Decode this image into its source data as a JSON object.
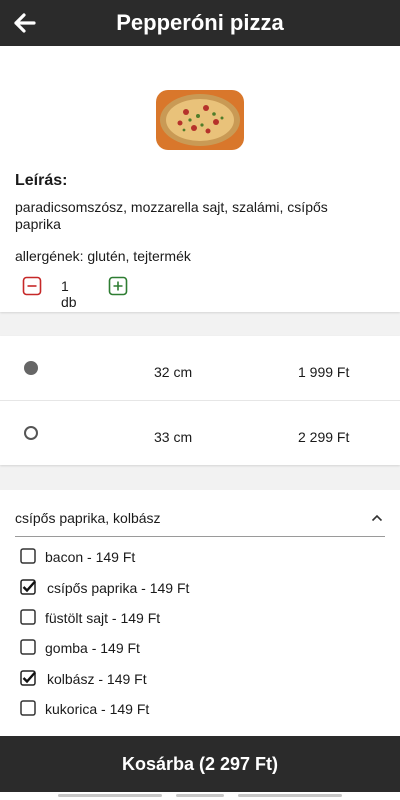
{
  "header": {
    "title": "Pepperóni pizza",
    "back_icon": "arrow-left-icon"
  },
  "product": {
    "image_icon": "pizza-photo",
    "description_heading": "Leírás:",
    "description": "paradicsomszósz, mozzarella  sajt, szalámi, csípős paprika",
    "allergens": "allergének: glutén, tejtermék",
    "quantity": "1 db",
    "minus_icon": "minus-square-icon",
    "plus_icon": "plus-square-icon",
    "colors": {
      "minus": "#c62828",
      "plus": "#2e7d32"
    }
  },
  "sizes": [
    {
      "label": "32 cm",
      "price": "1 999 Ft",
      "selected": true
    },
    {
      "label": "33 cm",
      "price": "2 299 Ft",
      "selected": false
    }
  ],
  "extras": {
    "selected_summary": "csípős paprika, kolbász",
    "items": [
      {
        "label": "bacon - 149 Ft",
        "checked": false
      },
      {
        "label": "csípős paprika - 149 Ft",
        "checked": true
      },
      {
        "label": "füstölt sajt - 149 Ft",
        "checked": false
      },
      {
        "label": "gomba - 149 Ft",
        "checked": false
      },
      {
        "label": "kolbász - 149 Ft",
        "checked": true
      },
      {
        "label": "kukorica - 149 Ft",
        "checked": false
      }
    ]
  },
  "cart": {
    "label": "Kosárba (2 297 Ft)"
  },
  "theme": {
    "bar": "#2b2b2b"
  }
}
